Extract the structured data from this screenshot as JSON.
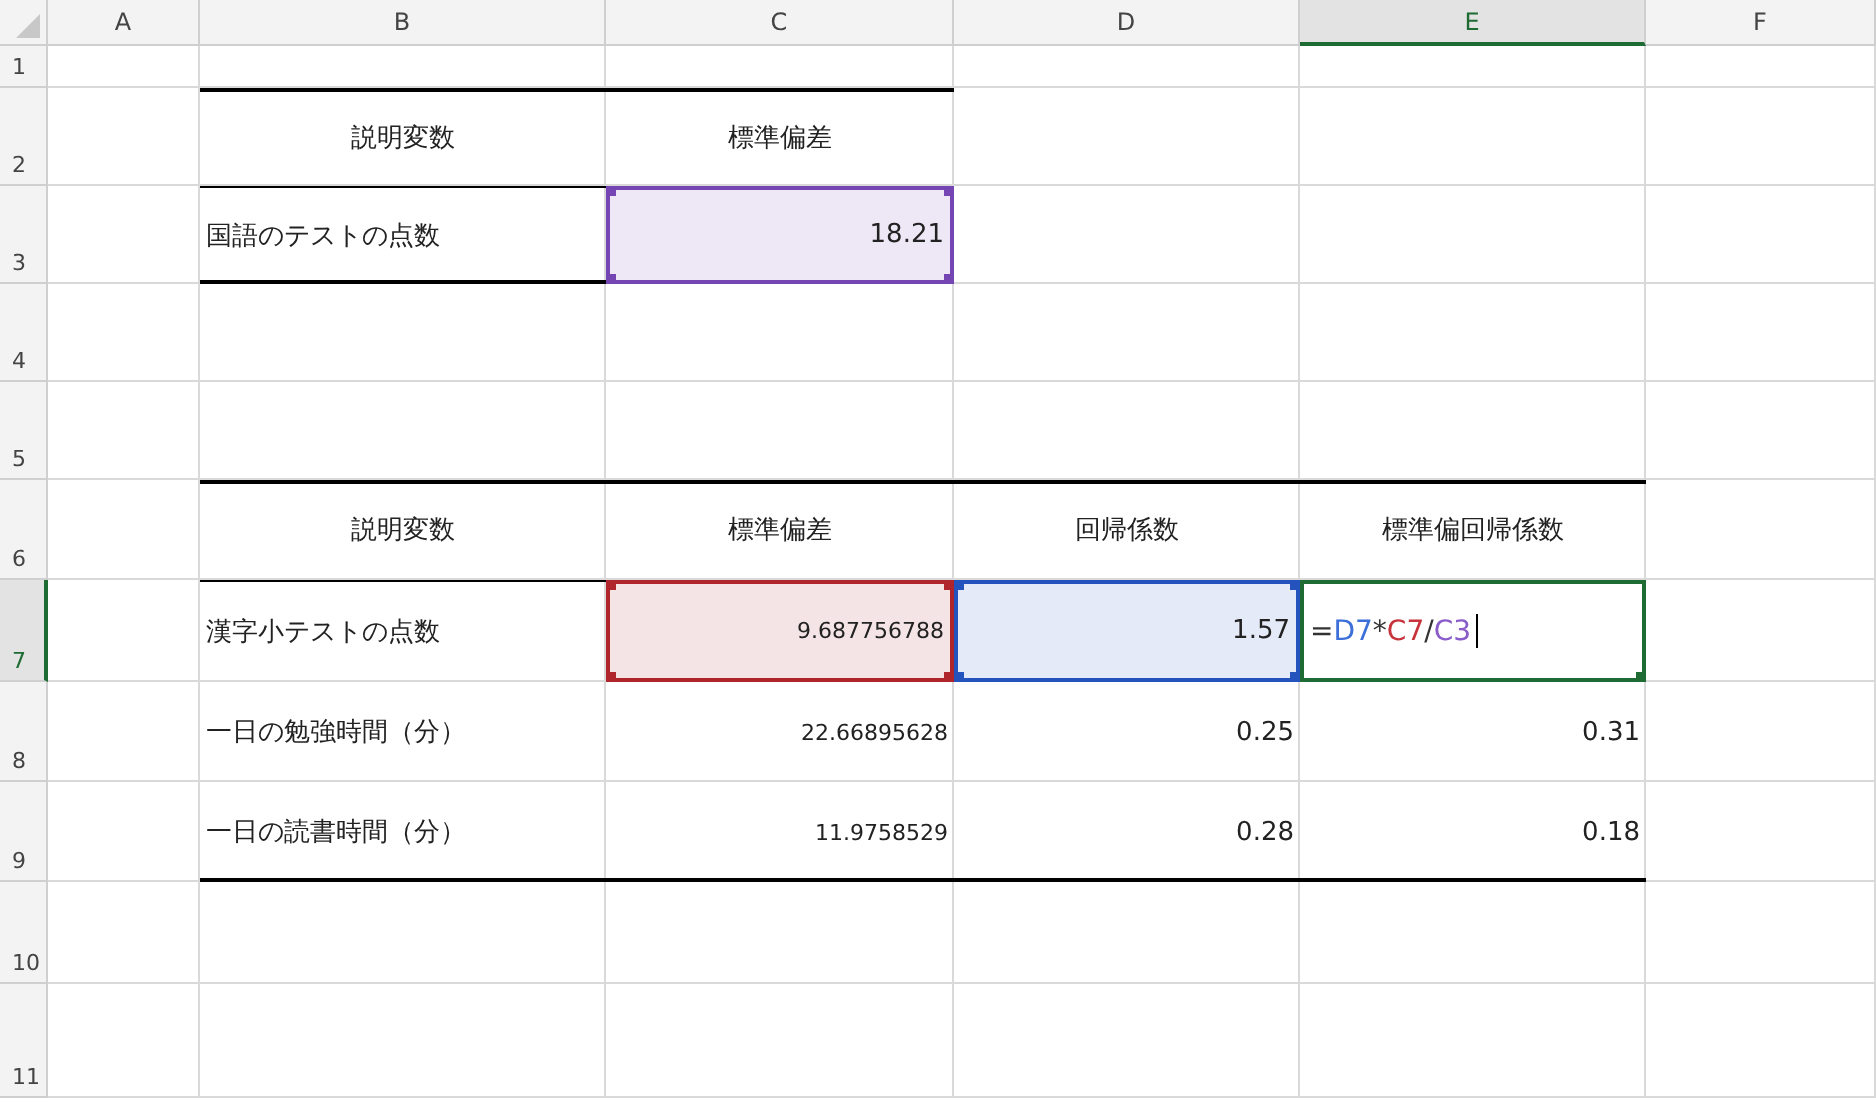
{
  "columns": [
    {
      "label": "A",
      "selected": false
    },
    {
      "label": "B",
      "selected": false
    },
    {
      "label": "C",
      "selected": false
    },
    {
      "label": "D",
      "selected": false
    },
    {
      "label": "E",
      "selected": true
    },
    {
      "label": "F",
      "selected": false
    }
  ],
  "rows": [
    {
      "number": "1",
      "selected": false
    },
    {
      "number": "2",
      "selected": false
    },
    {
      "number": "3",
      "selected": false
    },
    {
      "number": "4",
      "selected": false
    },
    {
      "number": "5",
      "selected": false
    },
    {
      "number": "6",
      "selected": false
    },
    {
      "number": "7",
      "selected": true
    },
    {
      "number": "8",
      "selected": false
    },
    {
      "number": "9",
      "selected": false
    },
    {
      "number": "10",
      "selected": false
    },
    {
      "number": "11",
      "selected": false
    }
  ],
  "tables": [
    {
      "header": [
        "説明変数",
        "標準偏差"
      ],
      "rows": [
        [
          {
            "kind": "label",
            "text": "国語のテストの点数"
          },
          {
            "kind": "number",
            "text": "18.21",
            "color": "#7545b3"
          }
        ]
      ]
    },
    {
      "header": [
        "説明変数",
        "標準偏差",
        "回帰係数",
        "標準偏回帰係数"
      ],
      "rows": [
        [
          {
            "kind": "label",
            "text": "漢字小テストの点数"
          },
          {
            "kind": "number",
            "text": "9.687756788",
            "small": true,
            "color": "#b0242c"
          },
          {
            "kind": "number",
            "text": "1.57",
            "color": "#2453bd"
          },
          {
            "kind": "formula",
            "color": "#1e6b34",
            "editing": true,
            "parts": [
              {
                "text": "=",
                "color": "#333333"
              },
              {
                "text": "D7",
                "color": "#3d6fd9"
              },
              {
                "text": "*",
                "color": "#333333"
              },
              {
                "text": "C7",
                "color": "#c8323a"
              },
              {
                "text": "/",
                "color": "#333333"
              },
              {
                "text": "C3",
                "color": "#8a5cc9"
              }
            ]
          }
        ],
        [
          {
            "kind": "label",
            "text": "一日の勉強時間（分）"
          },
          {
            "kind": "number",
            "text": "22.66895628",
            "small": true
          },
          {
            "kind": "number",
            "text": "0.25"
          },
          {
            "kind": "number",
            "text": "0.31"
          }
        ],
        [
          {
            "kind": "label",
            "text": "一日の読書時間（分）"
          },
          {
            "kind": "number",
            "text": "11.9758529",
            "small": true
          },
          {
            "kind": "number",
            "text": "0.28"
          },
          {
            "kind": "number",
            "text": "0.18"
          }
        ]
      ]
    }
  ]
}
